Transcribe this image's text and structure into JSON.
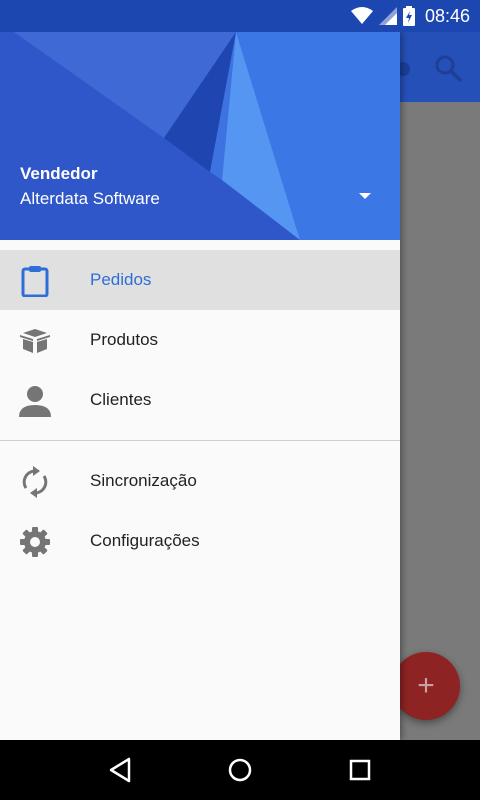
{
  "status_bar": {
    "time": "08:46"
  },
  "drawer": {
    "header": {
      "role": "Vendedor",
      "company": "Alterdata Software"
    },
    "items": [
      {
        "label": "Pedidos",
        "icon": "clipboard-icon",
        "active": true
      },
      {
        "label": "Produtos",
        "icon": "box-icon",
        "active": false
      },
      {
        "label": "Clientes",
        "icon": "person-icon",
        "active": false
      }
    ],
    "secondary_items": [
      {
        "label": "Sincronização",
        "icon": "sync-icon"
      },
      {
        "label": "Configurações",
        "icon": "gear-icon"
      }
    ]
  },
  "app": {
    "fab_symbol": "+"
  },
  "colors": {
    "header_blue": "#2f57c9",
    "status_bar": "#1d47b0",
    "active_label": "#2f6ed8",
    "fab": "#8d2323"
  }
}
